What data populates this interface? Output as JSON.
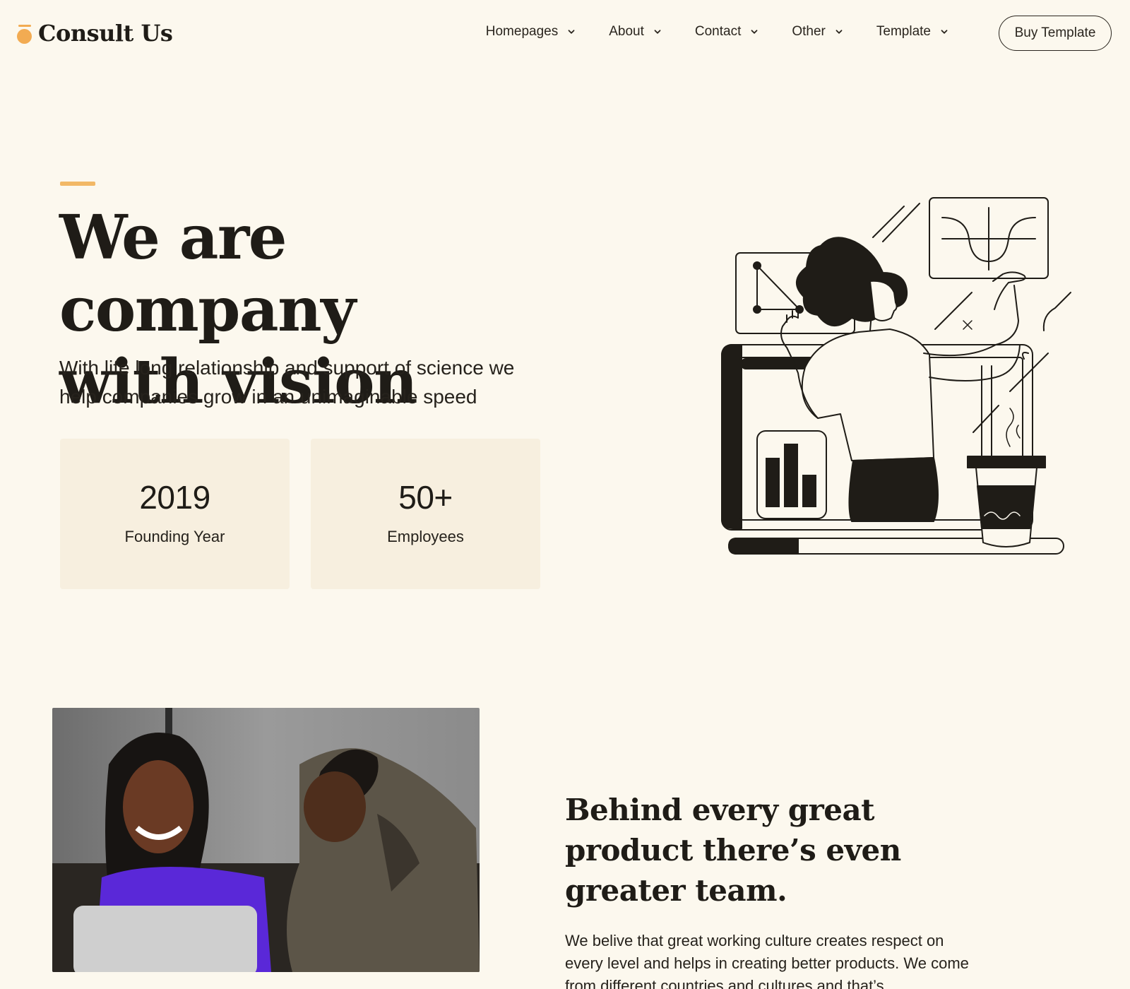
{
  "brand": {
    "name": "Consult Us",
    "accent": "#f2ab52"
  },
  "nav": {
    "items": [
      {
        "label": "Homepages"
      },
      {
        "label": "About"
      },
      {
        "label": "Contact"
      },
      {
        "label": "Other"
      },
      {
        "label": "Template"
      }
    ],
    "cta": "Buy Template"
  },
  "hero": {
    "title_line1": "We are company",
    "title_line2": "with vision",
    "subtitle": "With life long relationship and support of science we help companies grow in an unimaginable speed",
    "stats": [
      {
        "value": "2019",
        "label": "Founding Year"
      },
      {
        "value": "50+",
        "label": "Employees"
      }
    ]
  },
  "team": {
    "title": "Behind every great product there’s even greater team.",
    "body": "We belive that great working culture creates respect on every level and helps in creating better products. We come from different countries and cultures and that’s"
  }
}
